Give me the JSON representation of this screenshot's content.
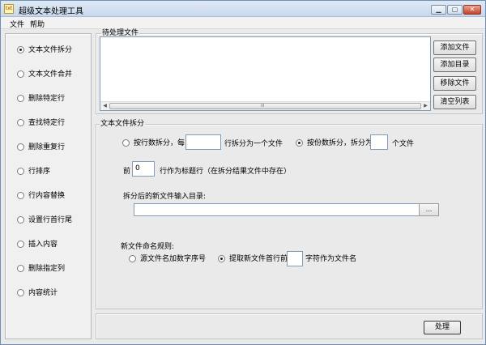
{
  "window": {
    "title": "超级文本处理工具",
    "icon_text": "txt"
  },
  "menu": {
    "file": "文件",
    "help": "帮助"
  },
  "sidebar": {
    "items": [
      {
        "label": "文本文件拆分",
        "checked": true
      },
      {
        "label": "文本文件合并",
        "checked": false
      },
      {
        "label": "删除特定行",
        "checked": false
      },
      {
        "label": "查找特定行",
        "checked": false
      },
      {
        "label": "删除重复行",
        "checked": false
      },
      {
        "label": "行排序",
        "checked": false
      },
      {
        "label": "行内容替换",
        "checked": false
      },
      {
        "label": "设置行首行尾",
        "checked": false
      },
      {
        "label": "插入内容",
        "checked": false
      },
      {
        "label": "删除指定列",
        "checked": false
      },
      {
        "label": "内容统计",
        "checked": false
      }
    ]
  },
  "pending": {
    "title": "待处理文件",
    "add_file": "添加文件",
    "add_dir": "添加目录",
    "remove_file": "移除文件",
    "clear_list": "清空列表",
    "scroll_grip": "III"
  },
  "split": {
    "title": "文本文件拆分",
    "by_lines_label": "按行数拆分，每",
    "by_lines_value": "",
    "by_lines_suffix": "行拆分为一个文件",
    "by_parts_label": "按份数拆分，拆分为",
    "by_parts_value": "",
    "by_parts_suffix": "个文件",
    "mode_by_parts_checked": true,
    "header_prefix": "前",
    "header_value": "0",
    "header_suffix": "行作为标题行（在拆分结果文件中存在）",
    "out_dir_label": "拆分后的新文件输入目录:",
    "out_dir_value": "",
    "browse": "...",
    "naming_label": "新文件命名规则:",
    "naming_opt1": "源文件名加数字序号",
    "naming_opt2": "提取新文件首行前",
    "naming_opt2_value": "",
    "naming_opt2_suffix": "字符作为文件名",
    "naming_opt2_checked": true
  },
  "actions": {
    "process": "处理"
  }
}
